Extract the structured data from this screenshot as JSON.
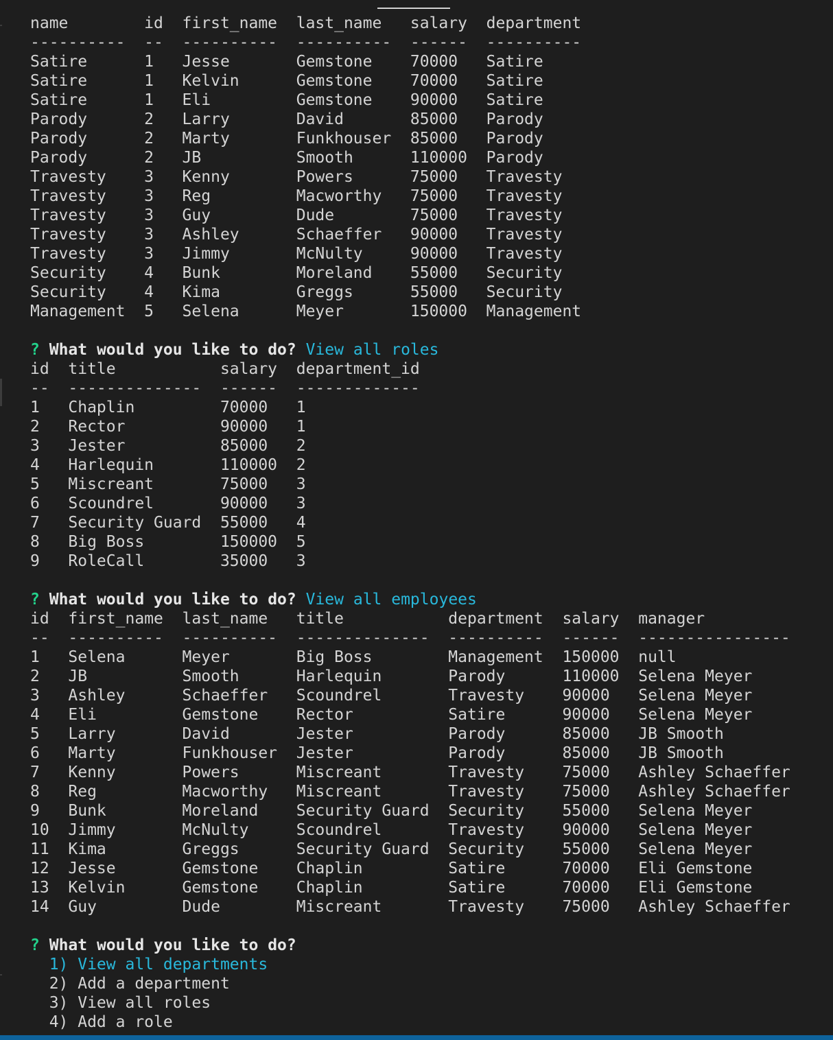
{
  "colors": {
    "background": "#1e1e1e",
    "text": "#d4d4d4",
    "prompt_mark": "#23d18b",
    "answer": "#29b8db",
    "status_bar": "#0e639c"
  },
  "lines": [
    "name        id  first_name  last_name   salary  department",
    "----------  --  ----------  ----------  ------  ----------",
    "Satire      1   Jesse       Gemstone    70000   Satire",
    "Satire      1   Kelvin      Gemstone    70000   Satire",
    "Satire      1   Eli         Gemstone    90000   Satire",
    "Parody      2   Larry       David       85000   Parody",
    "Parody      2   Marty       Funkhouser  85000   Parody",
    "Parody      2   JB          Smooth      110000  Parody",
    "Travesty    3   Kenny       Powers      75000   Travesty",
    "Travesty    3   Reg         Macworthy   75000   Travesty",
    "Travesty    3   Guy         Dude        75000   Travesty",
    "Travesty    3   Ashley      Schaeffer   90000   Travesty",
    "Travesty    3   Jimmy       McNulty     90000   Travesty",
    "Security    4   Bunk        Moreland    55000   Security",
    "Security    4   Kima        Greggs      55000   Security",
    "Management  5   Selena      Meyer       150000  Management",
    "",
    {
      "type": "prompt",
      "mark": "?",
      "question": "What would you like to do?",
      "answer": "View all roles"
    },
    "id  title           salary  department_id",
    "--  --------------  ------  -------------",
    "1   Chaplin         70000   1",
    "2   Rector          90000   1",
    "3   Jester          85000   2",
    "4   Harlequin       110000  2",
    "5   Miscreant       75000   3",
    "6   Scoundrel       90000   3",
    "7   Security Guard  55000   4",
    "8   Big Boss        150000  5",
    "9   RoleCall        35000   3",
    "",
    {
      "type": "prompt",
      "mark": "?",
      "question": "What would you like to do?",
      "answer": "View all employees"
    },
    "id  first_name  last_name   title           department  salary  manager",
    "--  ----------  ----------  --------------  ----------  ------  ----------------",
    "1   Selena      Meyer       Big Boss        Management  150000  null",
    "2   JB          Smooth      Harlequin       Parody      110000  Selena Meyer",
    "3   Ashley      Schaeffer   Scoundrel       Travesty    90000   Selena Meyer",
    "4   Eli         Gemstone    Rector          Satire      90000   Selena Meyer",
    "5   Larry       David       Jester          Parody      85000   JB Smooth",
    "6   Marty       Funkhouser  Jester          Parody      85000   JB Smooth",
    "7   Kenny       Powers      Miscreant       Travesty    75000   Ashley Schaeffer",
    "8   Reg         Macworthy   Miscreant       Travesty    75000   Ashley Schaeffer",
    "9   Bunk        Moreland    Security Guard  Security    55000   Selena Meyer",
    "10  Jimmy       McNulty     Scoundrel       Travesty    90000   Selena Meyer",
    "11  Kima        Greggs      Security Guard  Security    55000   Selena Meyer",
    "12  Jesse       Gemstone    Chaplin         Satire      70000   Eli Gemstone",
    "13  Kelvin      Gemstone    Chaplin         Satire      70000   Eli Gemstone",
    "14  Guy         Dude        Miscreant       Travesty    75000   Ashley Schaeffer",
    "",
    {
      "type": "prompt",
      "mark": "?",
      "question": "What would you like to do?",
      "answer": ""
    },
    {
      "type": "choice",
      "text": "  1) View all departments",
      "selected": true
    },
    {
      "type": "choice",
      "text": "  2) Add a department",
      "selected": false
    },
    {
      "type": "choice",
      "text": "  3) View all roles",
      "selected": false
    },
    {
      "type": "choice",
      "text": "  4) Add a role",
      "selected": false
    }
  ]
}
